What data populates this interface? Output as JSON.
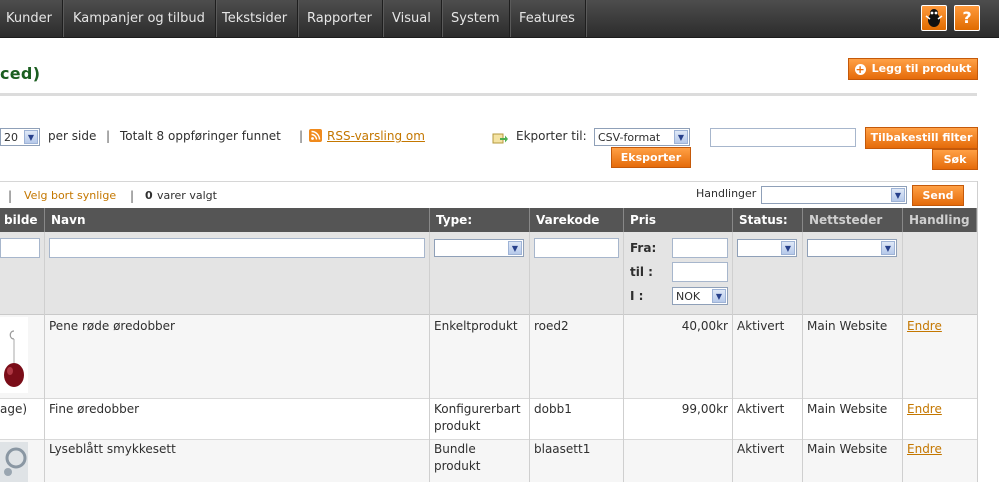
{
  "nav": {
    "items": [
      "Kunder",
      "Kampanjer og tilbud",
      "Tekstsider",
      "Rapporter",
      "Visual",
      "System",
      "Features"
    ],
    "icon_bug": "bug-icon",
    "icon_help": "help-icon",
    "help_glyph": "?"
  },
  "page": {
    "title_fragment": "ced)",
    "add_button": "Legg til produkt"
  },
  "pager": {
    "per_page_value": "20",
    "per_page_label": "per side",
    "sep": "|",
    "total": "Totalt 8 oppføringer funnet",
    "rss": "RSS-varsling om",
    "export_label": "Ekporter til:",
    "export_format": "CSV-format",
    "export_button": "Eksporter",
    "reset_button": "Tilbakestill filter",
    "search_button": "Søk"
  },
  "mass": {
    "unselect": "Velg bort synlige",
    "selected_count": "0",
    "selected_label": "varer valgt",
    "actions_label": "Handlinger",
    "send_button": "Send"
  },
  "columns": [
    "bilde",
    "Navn",
    "Type:",
    "Varekode",
    "Pris",
    "Status:",
    "Nettsteder",
    "Handling"
  ],
  "filters": {
    "price_from": "Fra:",
    "price_to": "til :",
    "currency_label": "I :",
    "currency": "NOK"
  },
  "rows": [
    {
      "image": "",
      "name": "Pene røde øredobber",
      "type": "Enkeltprodukt",
      "sku": "roed2",
      "price": "40,00kr",
      "status": "Aktivert",
      "website": "Main Website",
      "action": "Endre"
    },
    {
      "image": "age)",
      "name": "Fine øredobber",
      "type": "Konfigurerbart produkt",
      "sku": "dobb1",
      "price": "99,00kr",
      "status": "Aktivert",
      "website": "Main Website",
      "action": "Endre"
    },
    {
      "image": "",
      "name": "Lyseblått smykkesett",
      "type": "Bundle produkt",
      "sku": "blaasett1",
      "price": "",
      "status": "Aktivert",
      "website": "Main Website",
      "action": "Endre"
    }
  ]
}
